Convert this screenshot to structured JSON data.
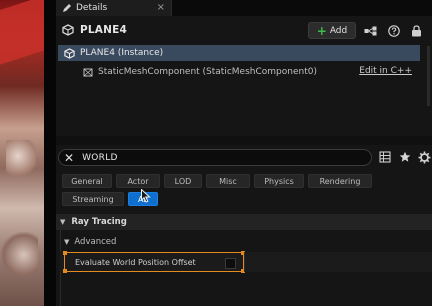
{
  "tab": {
    "label": "Details",
    "close": "×"
  },
  "header": {
    "actor_name": "PLANE4",
    "add_label": "Add"
  },
  "tree": {
    "instance_label": "PLANE4 (Instance)",
    "component_label": "StaticMeshComponent (StaticMeshComponent0)",
    "edit_link": "Edit in C++"
  },
  "search": {
    "value": "WORLD",
    "clear": "✕"
  },
  "filters": [
    {
      "label": "General",
      "active": false
    },
    {
      "label": "Actor",
      "active": false
    },
    {
      "label": "LOD",
      "active": false
    },
    {
      "label": "Misc",
      "active": false
    },
    {
      "label": "Physics",
      "active": false
    },
    {
      "label": "Rendering",
      "active": false
    },
    {
      "label": "Streaming",
      "active": false
    },
    {
      "label": "All",
      "active": true
    }
  ],
  "details": {
    "category": "Ray Tracing",
    "subcategory": "Advanced",
    "property_label": "Evaluate World Position Offset",
    "property_checked": false
  },
  "colors": {
    "accent": "#0f6fcf",
    "selection": "#e38a20",
    "add_plus": "#3fbd4a",
    "tree_selected": "#3a4a5e"
  }
}
